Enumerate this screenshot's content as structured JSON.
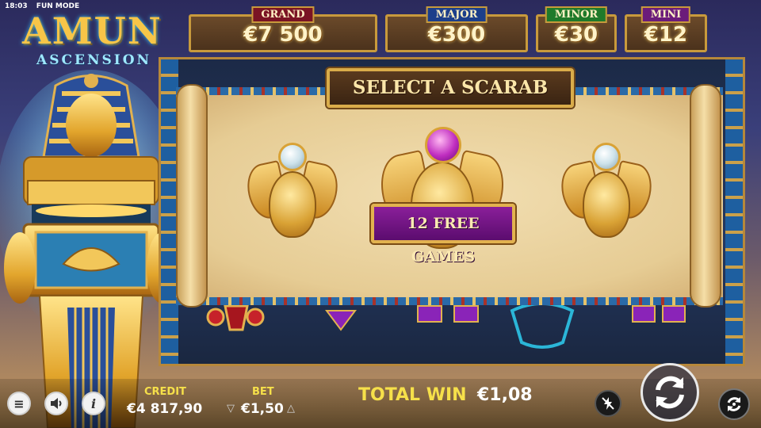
{
  "status": {
    "time": "18:03",
    "mode": "FUN MODE"
  },
  "logo": {
    "line1": "AMUN",
    "line2": "ASCENSION"
  },
  "jackpots": [
    {
      "label": "GRAND",
      "value": "€7 500",
      "color": "#7a1424"
    },
    {
      "label": "MAJOR",
      "value": "€300",
      "color": "#1c3f8a"
    },
    {
      "label": "MINOR",
      "value": "€30",
      "color": "#1f7a2a"
    },
    {
      "label": "MINI",
      "value": "€12",
      "color": "#6b1c7a"
    }
  ],
  "bonus": {
    "title": "SELECT A SCARAB",
    "revealed_prize": "12 FREE GAMES"
  },
  "bottom": {
    "credit_label": "CREDIT",
    "credit_value": "€4 817,90",
    "bet_label": "BET",
    "bet_value": "€1,50",
    "total_win_label": "TOTAL WIN",
    "total_win_value": "€1,08"
  },
  "icons": {
    "menu": "menu-icon",
    "sound": "speaker-icon",
    "info": "info-icon",
    "turbo": "lightning-off-icon",
    "spin": "spin-arrows-icon",
    "autoplay": "autoplay-icon"
  }
}
